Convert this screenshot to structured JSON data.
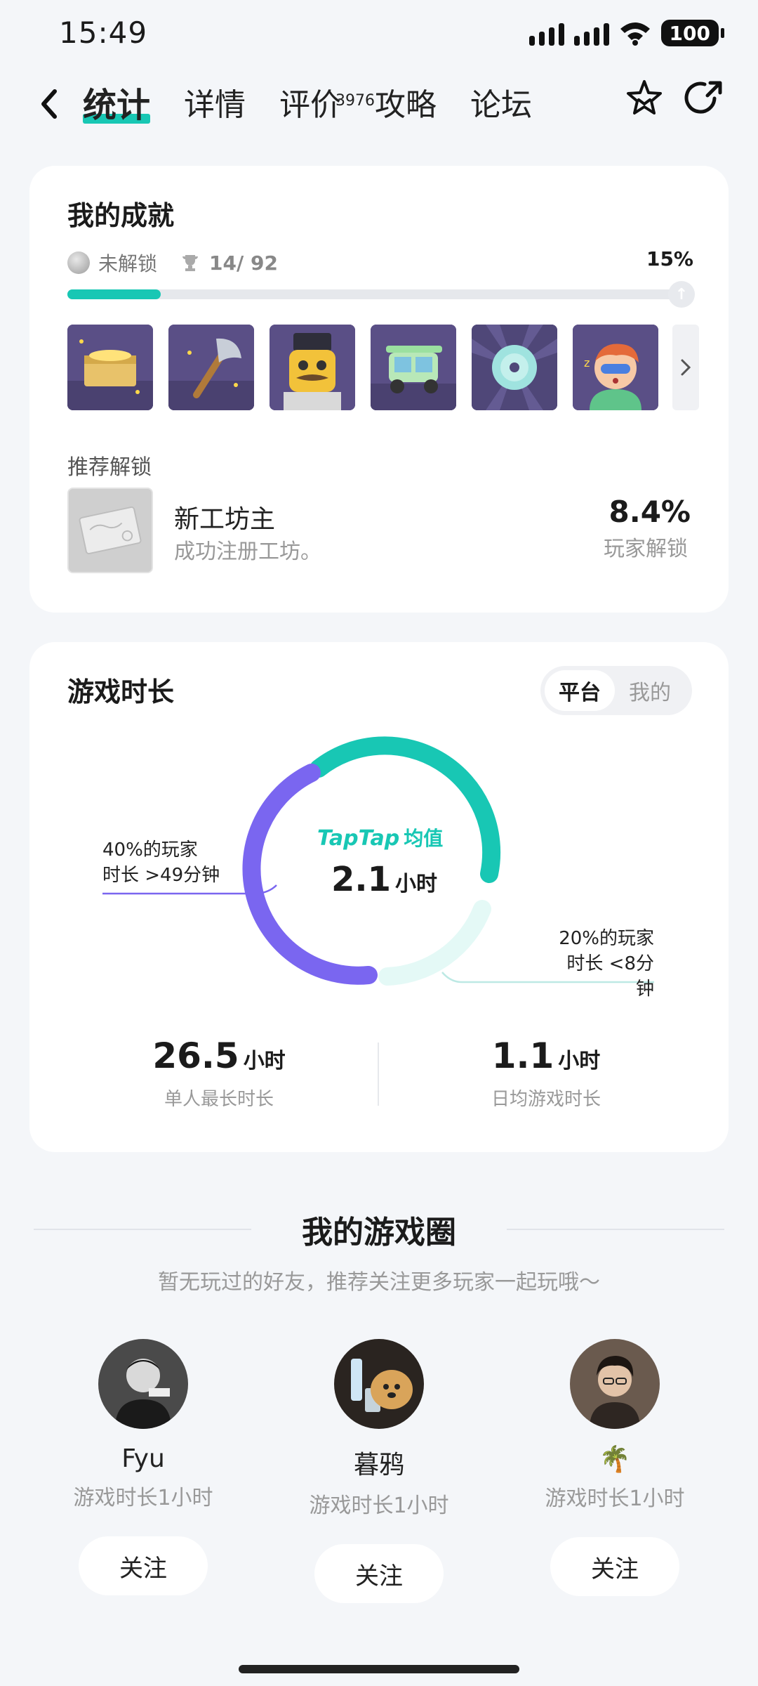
{
  "status": {
    "time": "15:49",
    "battery": "100"
  },
  "nav": {
    "tabs": [
      {
        "label": "统计"
      },
      {
        "label": "详情"
      },
      {
        "label": "评价",
        "badge": "3976"
      },
      {
        "label": "攻略"
      },
      {
        "label": "论坛"
      }
    ]
  },
  "achievements": {
    "title": "我的成就",
    "locked_label": "未解锁",
    "unlocked_count": "14/ 92",
    "progress_percent_label": "15%",
    "progress_fraction": 0.15,
    "badges": [
      "treasure-chest",
      "axe",
      "mustache-robot",
      "tuk-tuk",
      "cd-disc",
      "sleepy-kid"
    ],
    "recommend_label": "推荐解锁",
    "recommend": {
      "name": "新工坊主",
      "desc": "成功注册工坊。",
      "percent": "8.4%",
      "percent_label": "玩家解锁"
    }
  },
  "playtime": {
    "title": "游戏时长",
    "toggle": {
      "active": "平台",
      "inactive": "我的"
    },
    "left_ann": [
      "40%的玩家",
      "时长 >49分钟"
    ],
    "right_ann": [
      "20%的玩家",
      "时长 <8分钟"
    ],
    "center_logo": "TapTap",
    "center_logo_suffix": "均值",
    "center_value": "2.1",
    "center_unit": "小时",
    "stats": [
      {
        "value": "26.5",
        "unit": "小时",
        "label": "单人最长时长"
      },
      {
        "value": "1.1",
        "unit": "小时",
        "label": "日均游戏时长"
      }
    ],
    "colors": {
      "teal": "#18c7b4",
      "purple": "#7a66f0",
      "light": "#e4f9f6"
    }
  },
  "circle": {
    "title": "我的游戏圈",
    "subtitle": "暂无玩过的好友，推荐关注更多玩家一起玩哦～",
    "friends": [
      {
        "name": "Fyu",
        "playtime": "游戏时长1小时",
        "follow": "关注"
      },
      {
        "name": "暮鸦",
        "playtime": "游戏时长1小时",
        "follow": "关注"
      },
      {
        "name": "🌴",
        "playtime": "游戏时长1小时",
        "follow": "关注"
      }
    ]
  }
}
